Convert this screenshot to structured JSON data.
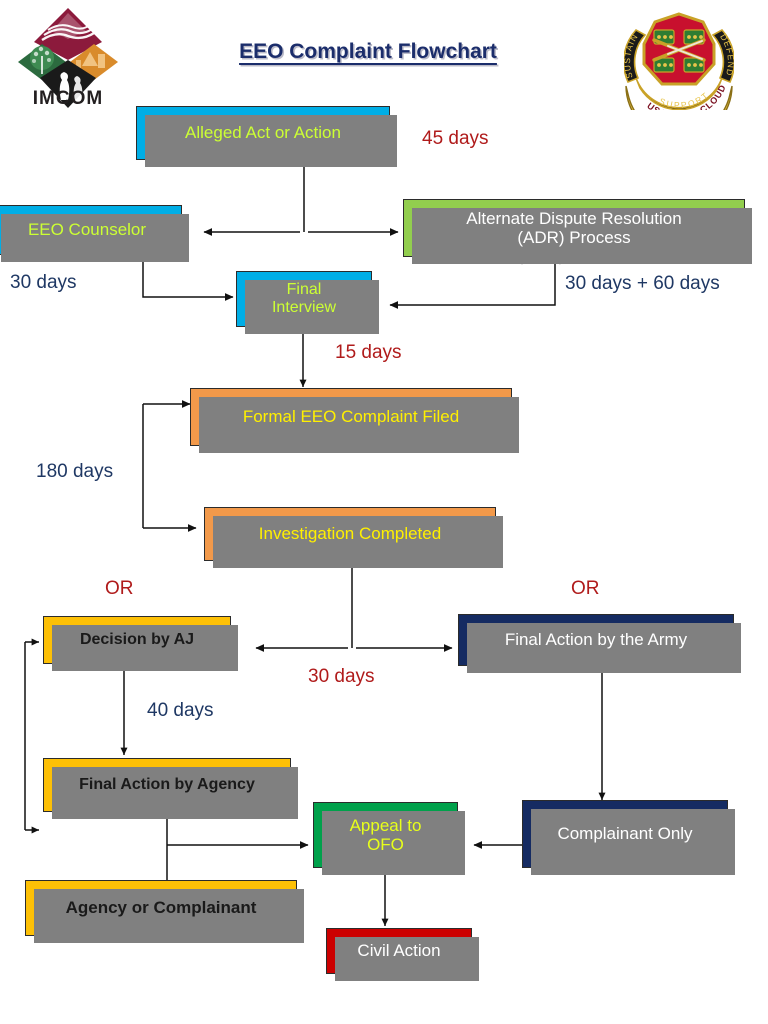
{
  "header": {
    "title": "EEO Complaint Flowchart",
    "left_logo": {
      "name": "IMCOM",
      "wordmark": "IMCOM",
      "tiles": [
        "flag-diamond",
        "tree-diamond",
        "buildings-diamond",
        "people-diamond"
      ]
    },
    "right_logo": {
      "name": "USAG-RED CLOUD crest",
      "motto_left": "SUSTAIN",
      "motto_right": "DEFEND",
      "motto_center": "SUPPORT",
      "scroll": "USAG-RED CLOUD"
    }
  },
  "colors": {
    "cyan": "#00AEE6",
    "green": "#92CE4E",
    "orange": "#F2994A",
    "gold": "#FDC006",
    "navy": "#152B62",
    "emerald": "#00A14B",
    "red": "#CC0000",
    "shadow": "#808080",
    "title_navy": "#1B2D6B",
    "label_navy": "#1F3864",
    "label_red": "#B01B1B",
    "yellow_green_text": "#CCFF33",
    "yellow_text": "#FFF000"
  },
  "nodes": [
    {
      "id": "alleged",
      "label": "Alleged Act or Action"
    },
    {
      "id": "counselor",
      "label": "EEO Counselor"
    },
    {
      "id": "adr_line1",
      "label": "Alternate Dispute Resolution"
    },
    {
      "id": "adr_line2",
      "label": "(ADR) Process"
    },
    {
      "id": "final_int_1",
      "label": "Final"
    },
    {
      "id": "final_int_2",
      "label": "Interview"
    },
    {
      "id": "formal",
      "label": "Formal EEO Complaint Filed"
    },
    {
      "id": "investigation",
      "label": "Investigation Completed"
    },
    {
      "id": "aj",
      "label": "Decision by AJ"
    },
    {
      "id": "army",
      "label": "Final Action by the Army"
    },
    {
      "id": "agency",
      "label": "Final Action by Agency"
    },
    {
      "id": "complainant_only",
      "label": "Complainant Only"
    },
    {
      "id": "appeal_1",
      "label": "Appeal to"
    },
    {
      "id": "appeal_2",
      "label": "OFO"
    },
    {
      "id": "agency_or",
      "label": "Agency or Complainant"
    },
    {
      "id": "civil",
      "label": "Civil Action"
    }
  ],
  "annotations": {
    "days_45": "45 days",
    "days_30_left": "30 days",
    "days_30_plus_60": "30 days + 60 days",
    "days_15": "15 days",
    "days_180": "180 days",
    "or_left": "OR",
    "or_right": "OR",
    "days_30_mid": "30 days",
    "days_40": "40 days"
  },
  "ghosts": {
    "adr": "(ADR) Process",
    "interview": "Interview"
  }
}
